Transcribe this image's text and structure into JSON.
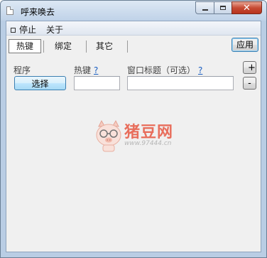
{
  "window": {
    "title": "呼来唤去"
  },
  "menu": {
    "stop": "停止",
    "about": "关于"
  },
  "tabs": [
    {
      "label": "热键",
      "active": true
    },
    {
      "label": "绑定",
      "active": false
    },
    {
      "label": "其它",
      "active": false
    }
  ],
  "buttons": {
    "apply": "应用",
    "select": "选择",
    "add": "+",
    "remove": "-"
  },
  "fields": {
    "program_label": "程序",
    "hotkey_label": "热键",
    "hotkey_help": "?",
    "window_title_label": "窗口标题（可选）",
    "window_title_help": "?",
    "hotkey_value": "",
    "window_title_value": ""
  },
  "watermark": {
    "brand": "猪豆网",
    "url": "www.97444.cn"
  },
  "colors": {
    "close_button": "#c74b34",
    "link": "#1b5fc2",
    "watermark_brand": "#e8604c"
  }
}
